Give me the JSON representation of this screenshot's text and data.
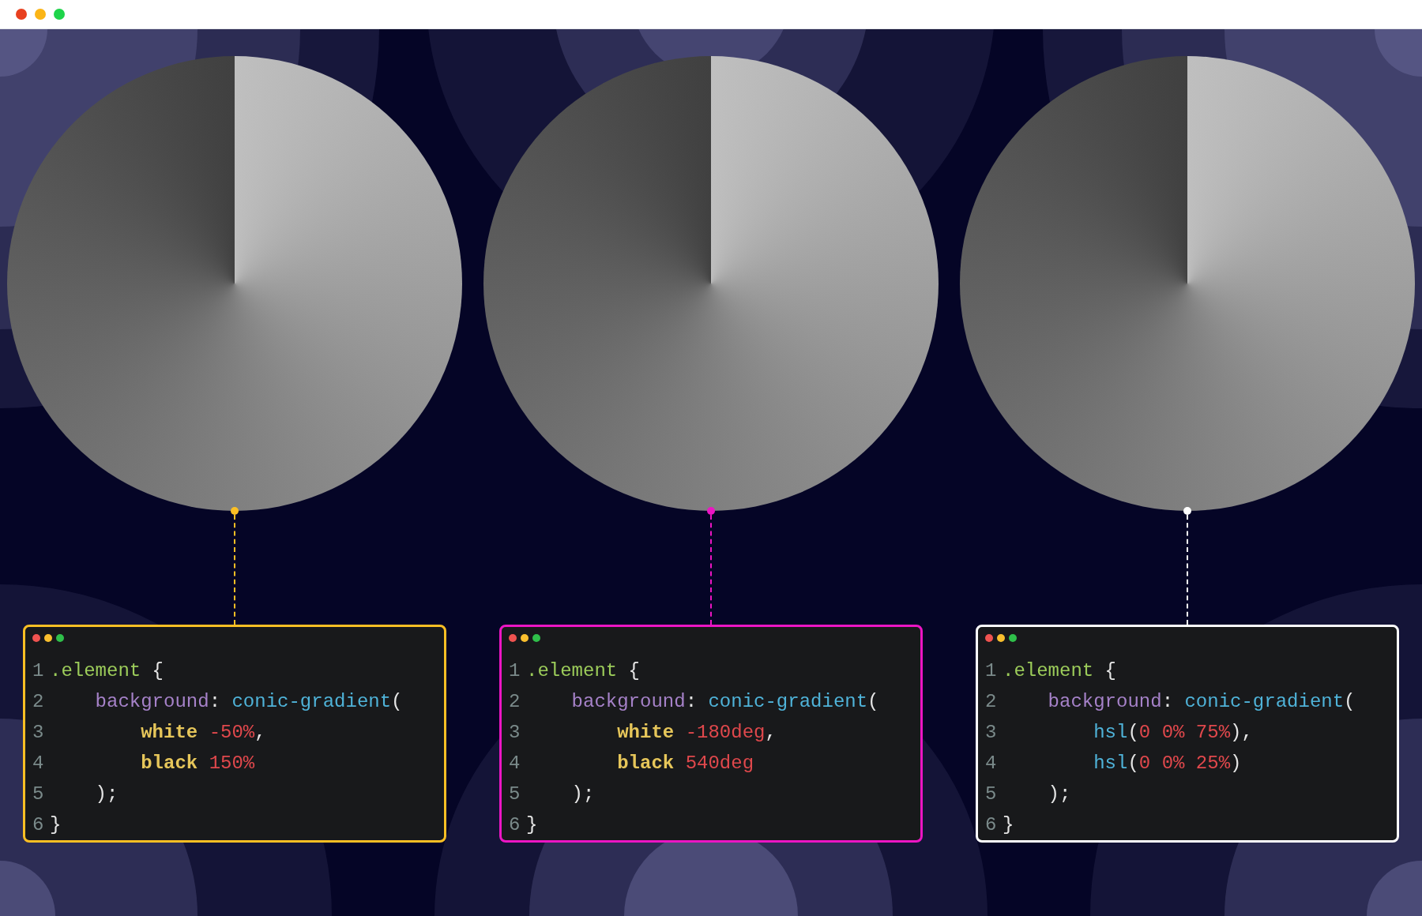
{
  "demos": [
    {
      "color": "#fbbf24",
      "lines": [
        {
          "number": "1",
          "kind": "open",
          "tokens": [
            {
              "kind": "selector",
              "text": ".element"
            },
            {
              "kind": "punct",
              "text": " {"
            }
          ]
        },
        {
          "number": "2",
          "kind": "declaration",
          "tokens": [
            {
              "kind": "property",
              "text": "background"
            },
            {
              "kind": "punct",
              "text": ": "
            },
            {
              "kind": "function",
              "text": "conic-gradient"
            },
            {
              "kind": "punct",
              "text": "("
            }
          ]
        },
        {
          "number": "3",
          "kind": "argument",
          "tokens": [
            {
              "kind": "keyword",
              "text": "white"
            },
            {
              "kind": "value",
              "text": "-50%"
            },
            {
              "kind": "punct",
              "text": ","
            }
          ]
        },
        {
          "number": "4",
          "kind": "argument",
          "tokens": [
            {
              "kind": "keyword",
              "text": "black"
            },
            {
              "kind": "value",
              "text": "150%"
            }
          ]
        },
        {
          "number": "5",
          "kind": "call_end",
          "tokens": [
            {
              "kind": "punct",
              "text": ");"
            }
          ]
        },
        {
          "number": "6",
          "kind": "close",
          "tokens": [
            {
              "kind": "punct",
              "text": "}"
            }
          ]
        }
      ]
    },
    {
      "color": "#ec15c4",
      "lines": [
        {
          "number": "1",
          "kind": "open",
          "tokens": [
            {
              "kind": "selector",
              "text": ".element"
            },
            {
              "kind": "punct",
              "text": " {"
            }
          ]
        },
        {
          "number": "2",
          "kind": "declaration",
          "tokens": [
            {
              "kind": "property",
              "text": "background"
            },
            {
              "kind": "punct",
              "text": ": "
            },
            {
              "kind": "function",
              "text": "conic-gradient"
            },
            {
              "kind": "punct",
              "text": "("
            }
          ]
        },
        {
          "number": "3",
          "kind": "argument",
          "tokens": [
            {
              "kind": "keyword",
              "text": "white"
            },
            {
              "kind": "value",
              "text": "-180deg"
            },
            {
              "kind": "punct",
              "text": ","
            }
          ]
        },
        {
          "number": "4",
          "kind": "argument",
          "tokens": [
            {
              "kind": "keyword",
              "text": "black"
            },
            {
              "kind": "value",
              "text": "540deg"
            }
          ]
        },
        {
          "number": "5",
          "kind": "call_end",
          "tokens": [
            {
              "kind": "punct",
              "text": ");"
            }
          ]
        },
        {
          "number": "6",
          "kind": "close",
          "tokens": [
            {
              "kind": "punct",
              "text": "}"
            }
          ]
        }
      ]
    },
    {
      "color": "#ffffff",
      "lines": [
        {
          "number": "1",
          "kind": "open",
          "tokens": [
            {
              "kind": "selector",
              "text": ".element"
            },
            {
              "kind": "punct",
              "text": " {"
            }
          ]
        },
        {
          "number": "2",
          "kind": "declaration",
          "tokens": [
            {
              "kind": "property",
              "text": "background"
            },
            {
              "kind": "punct",
              "text": ": "
            },
            {
              "kind": "function",
              "text": "conic-gradient"
            },
            {
              "kind": "punct",
              "text": "("
            }
          ]
        },
        {
          "number": "3",
          "kind": "argument",
          "tokens": [
            {
              "kind": "function",
              "text": "hsl"
            },
            {
              "kind": "punct",
              "text": "("
            },
            {
              "kind": "value",
              "text": "0 0% 75%"
            },
            {
              "kind": "punct",
              "text": "),"
            }
          ]
        },
        {
          "number": "4",
          "kind": "argument",
          "tokens": [
            {
              "kind": "function",
              "text": "hsl"
            },
            {
              "kind": "punct",
              "text": "("
            },
            {
              "kind": "value",
              "text": "0 0% 25%"
            },
            {
              "kind": "punct",
              "text": ")"
            }
          ]
        },
        {
          "number": "5",
          "kind": "call_end",
          "tokens": [
            {
              "kind": "punct",
              "text": ");"
            }
          ]
        },
        {
          "number": "6",
          "kind": "close",
          "tokens": [
            {
              "kind": "punct",
              "text": "}"
            }
          ]
        }
      ]
    }
  ]
}
